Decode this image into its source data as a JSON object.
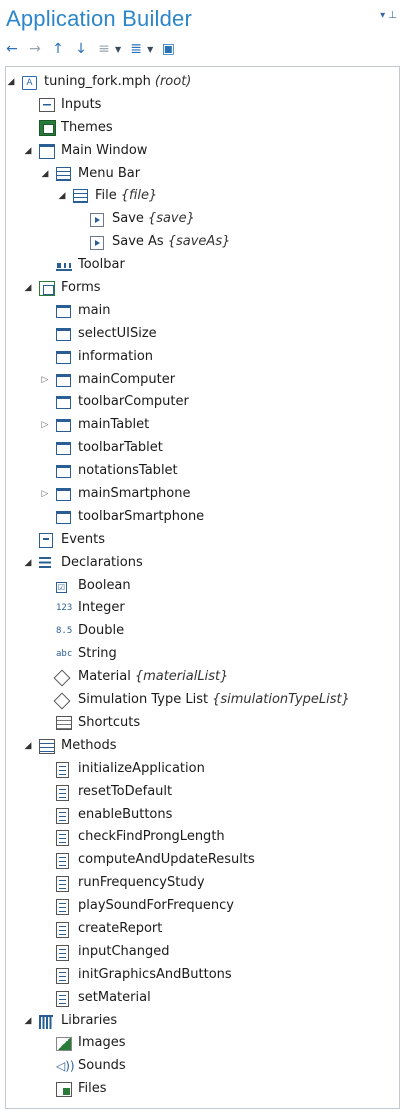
{
  "header": {
    "title": "Application Builder",
    "pin_glyph": "▾ ⊥"
  },
  "toolbar": {
    "buttons": [
      {
        "name": "back-icon",
        "glyph": "←",
        "gray": false
      },
      {
        "name": "forward-icon",
        "glyph": "→",
        "gray": true
      },
      {
        "name": "move-up-icon",
        "glyph": "↑",
        "gray": false
      },
      {
        "name": "move-down-icon",
        "glyph": "↓",
        "gray": false
      },
      {
        "name": "collapse-icon",
        "glyph": "≡",
        "gray": true,
        "drop": true
      },
      {
        "name": "expand-icon",
        "glyph": "≣",
        "gray": false,
        "drop": true
      },
      {
        "name": "form-editor-icon",
        "glyph": "▣",
        "gray": false
      }
    ]
  },
  "tree": [
    {
      "level": 0,
      "exp": "open",
      "icon": "app",
      "label": "tuning_fork.mph",
      "tag": "(root)"
    },
    {
      "level": 1,
      "exp": "",
      "icon": "inputs",
      "label": "Inputs",
      "tag": ""
    },
    {
      "level": 1,
      "exp": "",
      "icon": "themes",
      "label": "Themes",
      "tag": ""
    },
    {
      "level": 1,
      "exp": "open",
      "icon": "win",
      "label": "Main Window",
      "tag": ""
    },
    {
      "level": 2,
      "exp": "open",
      "icon": "menu",
      "label": "Menu Bar",
      "tag": ""
    },
    {
      "level": 3,
      "exp": "open",
      "icon": "menu",
      "label": "File",
      "tag": "{file}"
    },
    {
      "level": 4,
      "exp": "",
      "icon": "item",
      "label": "Save",
      "tag": "{save}"
    },
    {
      "level": 4,
      "exp": "",
      "icon": "item",
      "label": "Save As",
      "tag": "{saveAs}"
    },
    {
      "level": 2,
      "exp": "",
      "icon": "tool",
      "label": "Toolbar",
      "tag": ""
    },
    {
      "level": 1,
      "exp": "open",
      "icon": "forms",
      "label": "Forms",
      "tag": ""
    },
    {
      "level": 2,
      "exp": "",
      "icon": "form",
      "label": "main",
      "tag": ""
    },
    {
      "level": 2,
      "exp": "",
      "icon": "form",
      "label": "selectUISize",
      "tag": ""
    },
    {
      "level": 2,
      "exp": "",
      "icon": "form",
      "label": "information",
      "tag": ""
    },
    {
      "level": 2,
      "exp": "closed",
      "icon": "form",
      "label": "mainComputer",
      "tag": ""
    },
    {
      "level": 2,
      "exp": "",
      "icon": "form",
      "label": "toolbarComputer",
      "tag": ""
    },
    {
      "level": 2,
      "exp": "closed",
      "icon": "form",
      "label": "mainTablet",
      "tag": ""
    },
    {
      "level": 2,
      "exp": "",
      "icon": "form",
      "label": "toolbarTablet",
      "tag": ""
    },
    {
      "level": 2,
      "exp": "",
      "icon": "form",
      "label": "notationsTablet",
      "tag": ""
    },
    {
      "level": 2,
      "exp": "closed",
      "icon": "form",
      "label": "mainSmartphone",
      "tag": ""
    },
    {
      "level": 2,
      "exp": "",
      "icon": "form",
      "label": "toolbarSmartphone",
      "tag": ""
    },
    {
      "level": 1,
      "exp": "",
      "icon": "events",
      "label": "Events",
      "tag": ""
    },
    {
      "level": 1,
      "exp": "open",
      "icon": "decl",
      "label": "Declarations",
      "tag": ""
    },
    {
      "level": 2,
      "exp": "",
      "icon": "bool",
      "label": "Boolean",
      "tag": ""
    },
    {
      "level": 2,
      "exp": "",
      "icon": "int",
      "label": "Integer",
      "tag": ""
    },
    {
      "level": 2,
      "exp": "",
      "icon": "dbl",
      "label": "Double",
      "tag": ""
    },
    {
      "level": 2,
      "exp": "",
      "icon": "str",
      "label": "String",
      "tag": ""
    },
    {
      "level": 2,
      "exp": "",
      "icon": "diamond",
      "label": "Material",
      "tag": "{materialList}"
    },
    {
      "level": 2,
      "exp": "",
      "icon": "diamond",
      "label": "Simulation Type List",
      "tag": "{simulationTypeList}"
    },
    {
      "level": 2,
      "exp": "",
      "icon": "short",
      "label": "Shortcuts",
      "tag": ""
    },
    {
      "level": 1,
      "exp": "open",
      "icon": "methods",
      "label": "Methods",
      "tag": ""
    },
    {
      "level": 2,
      "exp": "",
      "icon": "method",
      "label": "initializeApplication",
      "tag": ""
    },
    {
      "level": 2,
      "exp": "",
      "icon": "method",
      "label": "resetToDefault",
      "tag": ""
    },
    {
      "level": 2,
      "exp": "",
      "icon": "method",
      "label": "enableButtons",
      "tag": ""
    },
    {
      "level": 2,
      "exp": "",
      "icon": "method",
      "label": "checkFindProngLength",
      "tag": ""
    },
    {
      "level": 2,
      "exp": "",
      "icon": "method",
      "label": "computeAndUpdateResults",
      "tag": ""
    },
    {
      "level": 2,
      "exp": "",
      "icon": "method",
      "label": "runFrequencyStudy",
      "tag": ""
    },
    {
      "level": 2,
      "exp": "",
      "icon": "method",
      "label": "playSoundForFrequency",
      "tag": ""
    },
    {
      "level": 2,
      "exp": "",
      "icon": "method",
      "label": "createReport",
      "tag": ""
    },
    {
      "level": 2,
      "exp": "",
      "icon": "method",
      "label": "inputChanged",
      "tag": ""
    },
    {
      "level": 2,
      "exp": "",
      "icon": "method",
      "label": "initGraphicsAndButtons",
      "tag": ""
    },
    {
      "level": 2,
      "exp": "",
      "icon": "method",
      "label": "setMaterial",
      "tag": ""
    },
    {
      "level": 1,
      "exp": "open",
      "icon": "lib",
      "label": "Libraries",
      "tag": ""
    },
    {
      "level": 2,
      "exp": "",
      "icon": "images",
      "label": "Images",
      "tag": ""
    },
    {
      "level": 2,
      "exp": "",
      "icon": "sounds",
      "label": "Sounds",
      "tag": ""
    },
    {
      "level": 2,
      "exp": "",
      "icon": "files",
      "label": "Files",
      "tag": ""
    }
  ]
}
